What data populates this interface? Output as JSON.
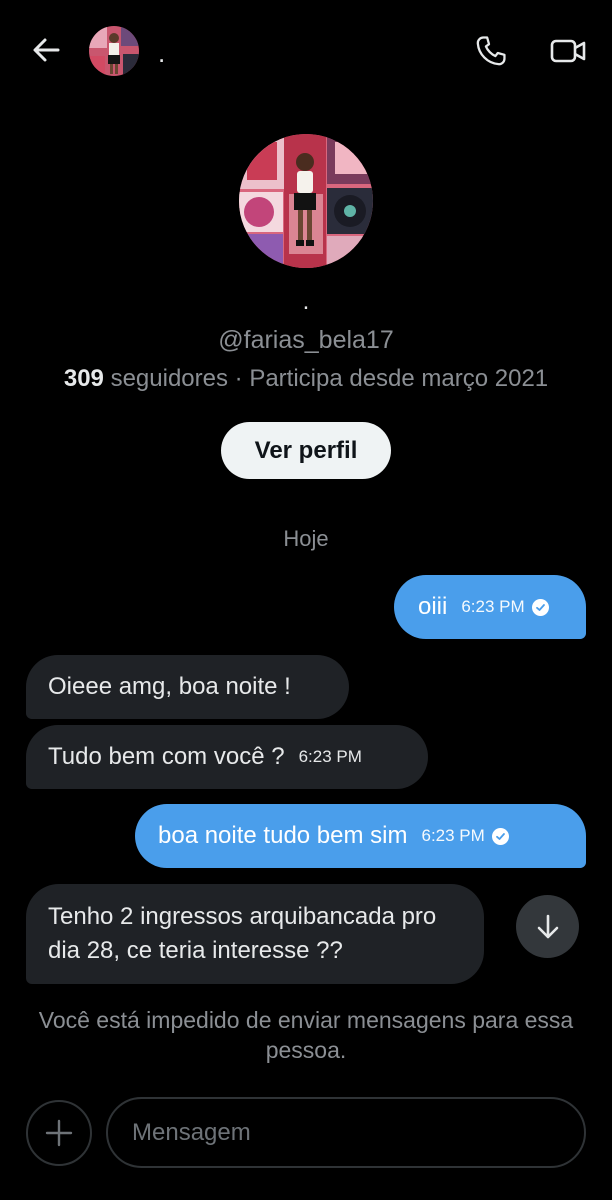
{
  "header": {
    "name": ".",
    "back_icon": "arrow-left-icon",
    "call_icon": "phone-icon",
    "video_icon": "video-camera-icon"
  },
  "profile": {
    "name": ".",
    "handle": "@farias_bela17",
    "followers_count": "309",
    "followers_label": "seguidores",
    "joined": "· Participa desde março 2021",
    "view_profile_label": "Ver perfil"
  },
  "conversation": {
    "date_separator": "Hoje",
    "messages": [
      {
        "direction": "outgoing",
        "text": "oiii",
        "time": "6:23 PM",
        "read": true
      },
      {
        "direction": "incoming",
        "text": "Oieee amg, boa noite !"
      },
      {
        "direction": "incoming",
        "text": "Tudo bem com você ?",
        "time": "6:23 PM"
      },
      {
        "direction": "outgoing",
        "text": "boa noite tudo bem sim",
        "time": "6:23 PM",
        "read": true
      },
      {
        "direction": "incoming",
        "text": "Tenho 2 ingressos arquibancada pro dia 28, ce teria interesse ??"
      }
    ]
  },
  "footer": {
    "blocked_notice": "Você está impedido de enviar mensagens para essa pessoa.",
    "input_placeholder": "Mensagem",
    "plus_icon": "plus-icon",
    "scroll_icon": "arrow-down-icon"
  },
  "colors": {
    "background": "#000000",
    "outgoing_bubble": "#4a9eeb",
    "incoming_bubble": "#1f2226",
    "muted_text": "#8b8f94"
  }
}
